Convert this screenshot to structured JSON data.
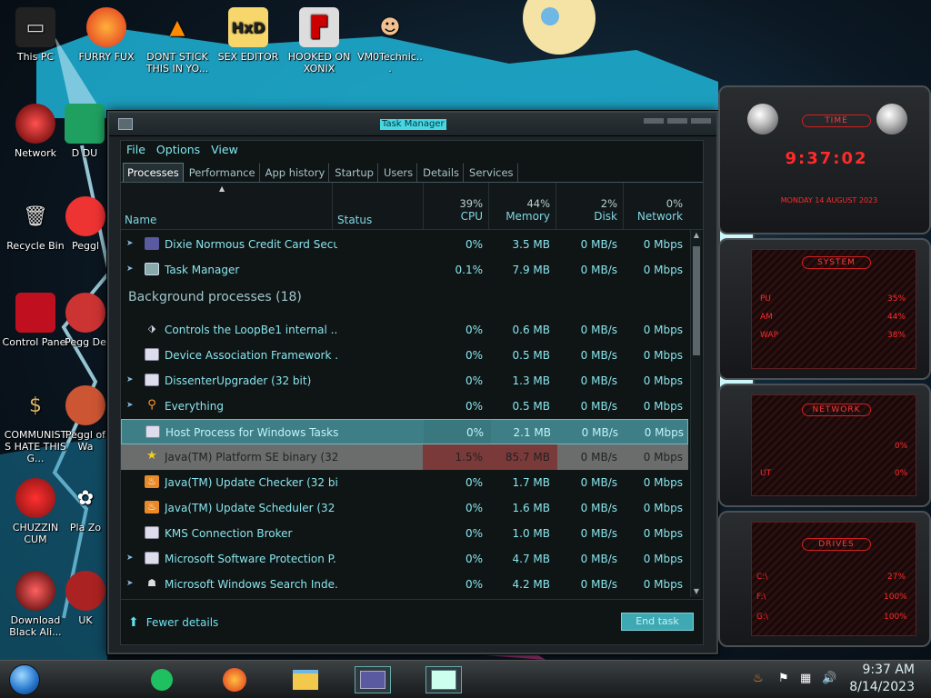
{
  "desktop": {
    "icons": [
      {
        "label": "This PC"
      },
      {
        "label": "FURRY FUX"
      },
      {
        "label": "DONT STICK THIS IN YO..."
      },
      {
        "label": "SEX EDITOR"
      },
      {
        "label": "HOOKED ON XONIX"
      },
      {
        "label": "VM0Technic..."
      },
      {
        "label": "Network"
      },
      {
        "label": "D DU"
      },
      {
        "label": "Recycle Bin"
      },
      {
        "label": "Peggl"
      },
      {
        "label": "Control Panel"
      },
      {
        "label": "Pegg De"
      },
      {
        "label": "COMMUNISTS HATE THIS G..."
      },
      {
        "label": "Peggl of Wa"
      },
      {
        "label": "CHUZZIN CUM"
      },
      {
        "label": "Pla Zo"
      },
      {
        "label": "Download Black Ali..."
      },
      {
        "label": "UK"
      }
    ]
  },
  "task_manager": {
    "title": "Task Manager",
    "menu": [
      "File",
      "Options",
      "View"
    ],
    "tabs": [
      "Processes",
      "Performance",
      "App history",
      "Startup",
      "Users",
      "Details",
      "Services"
    ],
    "columns": {
      "name": "Name",
      "status": "Status",
      "cpu_pct": "39%",
      "cpu": "CPU",
      "mem_pct": "44%",
      "mem": "Memory",
      "disk_pct": "2%",
      "disk": "Disk",
      "net_pct": "0%",
      "net": "Network"
    },
    "apps": [
      {
        "name": "Dixie Normous Credit Card Secu...",
        "cpu": "0%",
        "mem": "3.5 MB",
        "disk": "0 MB/s",
        "net": "0 Mbps"
      },
      {
        "name": "Task Manager",
        "cpu": "0.1%",
        "mem": "7.9 MB",
        "disk": "0 MB/s",
        "net": "0 Mbps"
      }
    ],
    "background_title": "Background processes (18)",
    "background": [
      {
        "name": "Controls the LoopBe1 internal ...",
        "cpu": "0%",
        "mem": "0.6 MB",
        "disk": "0 MB/s",
        "net": "0 Mbps"
      },
      {
        "name": "Device Association Framework ...",
        "cpu": "0%",
        "mem": "0.5 MB",
        "disk": "0 MB/s",
        "net": "0 Mbps"
      },
      {
        "name": "DissenterUpgrader (32 bit)",
        "cpu": "0%",
        "mem": "1.3 MB",
        "disk": "0 MB/s",
        "net": "0 Mbps"
      },
      {
        "name": "Everything",
        "cpu": "0%",
        "mem": "0.5 MB",
        "disk": "0 MB/s",
        "net": "0 Mbps"
      },
      {
        "name": "Host Process for Windows Tasks",
        "cpu": "0%",
        "mem": "2.1 MB",
        "disk": "0 MB/s",
        "net": "0 Mbps"
      },
      {
        "name": "Java(TM) Platform SE binary (32...",
        "cpu": "1.5%",
        "mem": "85.7 MB",
        "disk": "0 MB/s",
        "net": "0 Mbps"
      },
      {
        "name": "Java(TM) Update Checker (32 bit)",
        "cpu": "0%",
        "mem": "1.7 MB",
        "disk": "0 MB/s",
        "net": "0 Mbps"
      },
      {
        "name": "Java(TM) Update Scheduler (32 ...",
        "cpu": "0%",
        "mem": "1.6 MB",
        "disk": "0 MB/s",
        "net": "0 Mbps"
      },
      {
        "name": "KMS Connection Broker",
        "cpu": "0%",
        "mem": "1.0 MB",
        "disk": "0 MB/s",
        "net": "0 Mbps"
      },
      {
        "name": "Microsoft Software Protection P...",
        "cpu": "0%",
        "mem": "4.7 MB",
        "disk": "0 MB/s",
        "net": "0 Mbps"
      },
      {
        "name": "Microsoft Windows Search Inde...",
        "cpu": "0%",
        "mem": "4.2 MB",
        "disk": "0 MB/s",
        "net": "0 Mbps"
      }
    ],
    "fewer_details": "Fewer details",
    "end_task": "End task"
  },
  "gadget": {
    "time_title": "TIME",
    "time_value": "9:37:02",
    "date_value": "MONDAY 14 AUGUST 2023",
    "system_title": "SYSTEM",
    "cpu_label": "PU",
    "cpu_value": "35%",
    "ram_label": "AM",
    "ram_value": "44%",
    "swap_label": "WAP",
    "swap_value": "38%",
    "network_title": "NETWORK",
    "net_in_value": "0%",
    "net_out_label": "UT",
    "net_out_value": "0%",
    "drives_title": "DRIVES",
    "drive_c": "C:\\",
    "drive_c_value": "27%",
    "drive_f": "F:\\",
    "drive_f_value": "100%",
    "drive_g": "G:\\",
    "drive_g_value": "100%"
  },
  "taskbar": {
    "time": "9:37 AM",
    "date": "8/14/2023"
  }
}
